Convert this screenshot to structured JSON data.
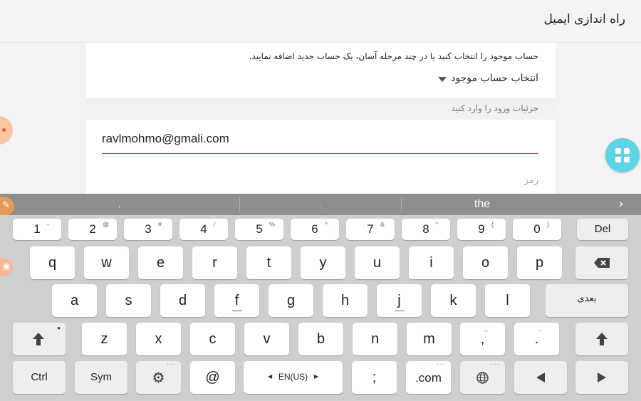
{
  "app": {
    "title": "راه اندازی ایمیل"
  },
  "form": {
    "description": "حساب موجود را انتخاب کنید یا در چند مرحله آسان، یک حساب جدید اضافه نمایید.",
    "select_existing_label": "انتخاب حساب موجود",
    "login_details_header": "جزئیات ورود را وارد کنید",
    "email_value": "ravlmohmo@gmali.com",
    "password_placeholder": "رمز"
  },
  "suggestions": {
    "left": ".",
    "middle": ",",
    "right": "the"
  },
  "colors": {
    "accent": "#5ed4e6",
    "input_underline": "#e0394a",
    "suggestion_bar": "#8e8e8e"
  },
  "keyboard": {
    "number_row": [
      {
        "main": "1",
        "sup": "-"
      },
      {
        "main": "2",
        "sup": "@"
      },
      {
        "main": "3",
        "sup": "#"
      },
      {
        "main": "4",
        "sup": "/"
      },
      {
        "main": "5",
        "sup": "%"
      },
      {
        "main": "6",
        "sup": "^"
      },
      {
        "main": "7",
        "sup": "&"
      },
      {
        "main": "8",
        "sup": "*"
      },
      {
        "main": "9",
        "sup": "("
      },
      {
        "main": "0",
        "sup": ")"
      }
    ],
    "del_label": "Del",
    "row_q": [
      "q",
      "w",
      "e",
      "r",
      "t",
      "y",
      "u",
      "i",
      "o",
      "p"
    ],
    "row_a": [
      "a",
      "s",
      "d",
      "f",
      "g",
      "h",
      "j",
      "k",
      "l"
    ],
    "next_label": "بعدی",
    "row_z": [
      "z",
      "x",
      "c",
      "v",
      "b",
      "n",
      "m"
    ],
    "comma_key": {
      "main": ",",
      "sup": "–"
    },
    "period_key": {
      "main": ".",
      "sup": "-"
    },
    "ctrl_label": "Ctrl",
    "sym_label": "Sym",
    "at_label": "@",
    "language_label": "EN(US)",
    "semicolon_label": ";",
    "dotcom_label": ".com",
    "icons": {
      "shift": "shift-icon",
      "backspace": "backspace-icon",
      "settings": "gear-icon",
      "globe": "globe-icon",
      "left": "arrow-left-icon",
      "right": "arrow-right-icon"
    }
  }
}
